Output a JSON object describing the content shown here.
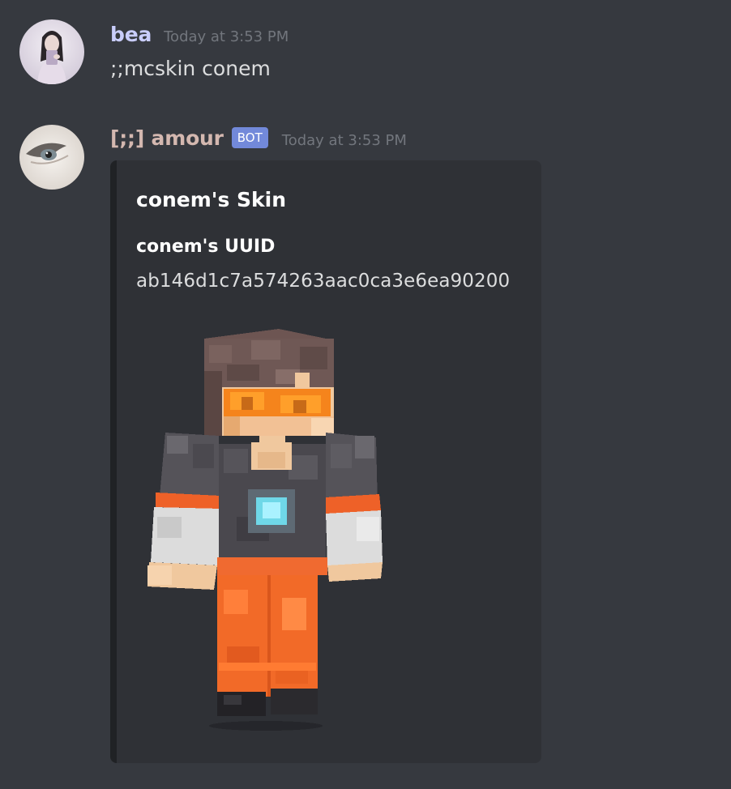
{
  "messages": [
    {
      "username": "bea",
      "username_color": "#c9cdfb",
      "timestamp": "Today at 3:53 PM",
      "content": ";;mcskin conem"
    },
    {
      "username": "[;;] amour",
      "username_color": "#d4b8b0",
      "bot_tag": "BOT",
      "timestamp": "Today at 3:53 PM",
      "embed": {
        "title": "conem's Skin",
        "field_name": "conem's UUID",
        "field_value": "ab146d1c7a574263aac0ca3e6ea90200",
        "image": "minecraft-skin-render"
      }
    }
  ],
  "colors": {
    "background": "#36393f",
    "embed_background": "#2f3136",
    "bot_tag": "#7289da",
    "timestamp": "#72767d"
  }
}
